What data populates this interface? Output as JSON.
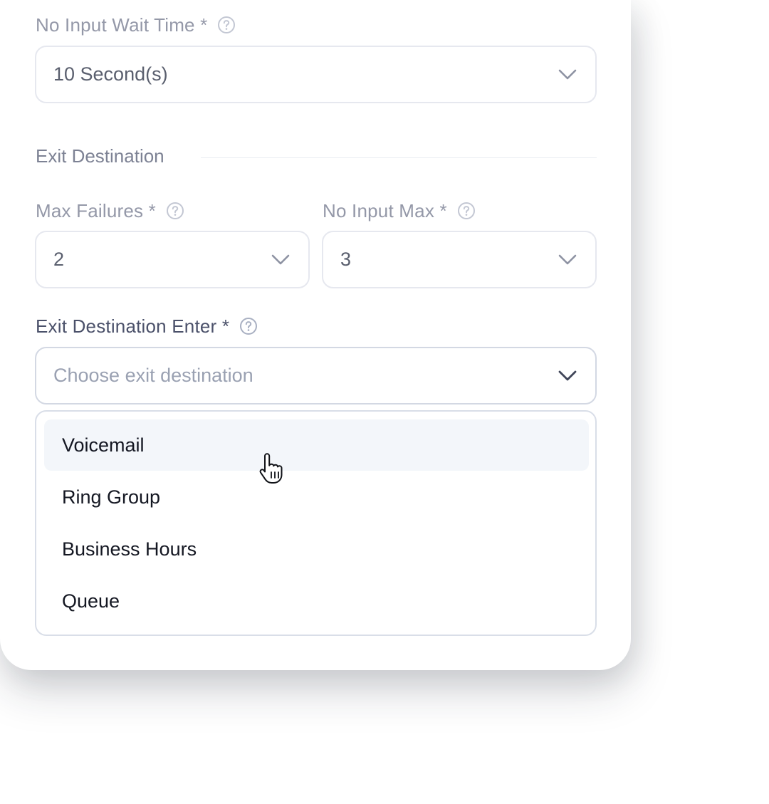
{
  "form": {
    "no_input_wait_time": {
      "label": "No Input Wait Time *",
      "value": "10 Second(s)"
    },
    "exit_section": {
      "title": "Exit Destination"
    },
    "max_failures": {
      "label": "Max Failures *",
      "value": "2"
    },
    "no_input_max": {
      "label": "No Input Max *",
      "value": "3"
    },
    "exit_destination_enter": {
      "label": "Exit Destination Enter *",
      "placeholder": "Choose exit destination",
      "options": [
        "Voicemail",
        "Ring Group",
        "Business Hours",
        "Queue"
      ],
      "hovered_option": "Voicemail"
    }
  },
  "icons": {
    "help": "question-circle-icon",
    "dropdown": "chevron-down-icon",
    "cursor": "hand-pointer-icon"
  },
  "colors": {
    "label": "#9498a8",
    "label_active": "#4b516a",
    "field_border": "#e6e8ef",
    "hover_bg": "#f3f6fa",
    "text_dark": "#141722"
  }
}
